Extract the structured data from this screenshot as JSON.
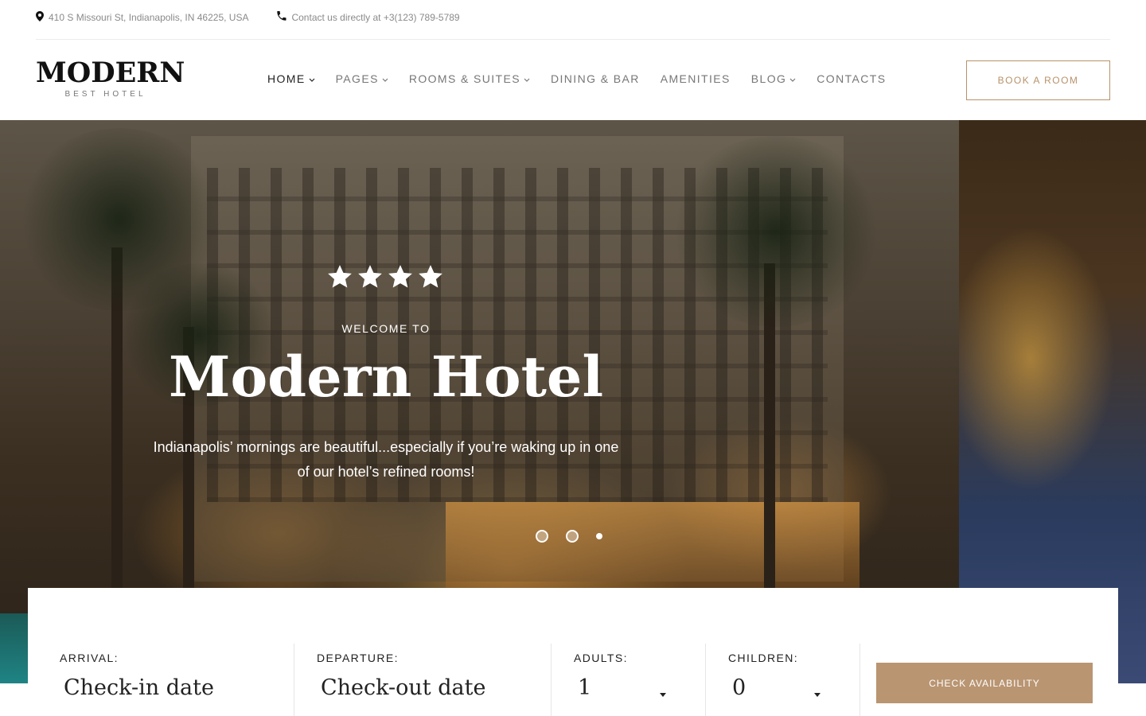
{
  "topbar": {
    "address": "410 S Missouri St, Indianapolis, IN 46225, USA",
    "contact": "Contact us directly at +3(123) 789-5789"
  },
  "logo": {
    "main": "MODERN",
    "sub": "BEST HOTEL"
  },
  "nav": {
    "items": [
      {
        "label": "HOME",
        "has_dropdown": true,
        "active": true
      },
      {
        "label": "PAGES",
        "has_dropdown": true
      },
      {
        "label": "ROOMS & SUITES",
        "has_dropdown": true
      },
      {
        "label": "DINING & BAR"
      },
      {
        "label": "AMENITIES"
      },
      {
        "label": "BLOG",
        "has_dropdown": true
      },
      {
        "label": "CONTACTS"
      }
    ]
  },
  "book_button": "BOOK A ROOM",
  "hero": {
    "rating_stars": 4,
    "welcome": "WELCOME TO",
    "title": "Modern Hotel",
    "subtitle_line1": "Indianapolis’ mornings are beautiful...especially if you’re waking up in one",
    "subtitle_line2": "of our hotel’s refined rooms!",
    "slide_count": 3,
    "active_slide": 3
  },
  "booking": {
    "arrival_label": "ARRIVAL:",
    "arrival_placeholder": "Check-in date",
    "departure_label": "DEPARTURE:",
    "departure_placeholder": "Check-out date",
    "adults_label": "ADULTS:",
    "adults_value": "1",
    "children_label": "CHILDREN:",
    "children_value": "0",
    "check_button": "CHECK AVAILABILITY"
  },
  "colors": {
    "accent": "#b99572",
    "accent_border": "#b8926a",
    "nav_text": "#777777"
  },
  "icons": {
    "address": "map-pin-icon",
    "contact": "phone-icon",
    "dropdown": "chevron-down-icon",
    "rating": "star-icon"
  }
}
